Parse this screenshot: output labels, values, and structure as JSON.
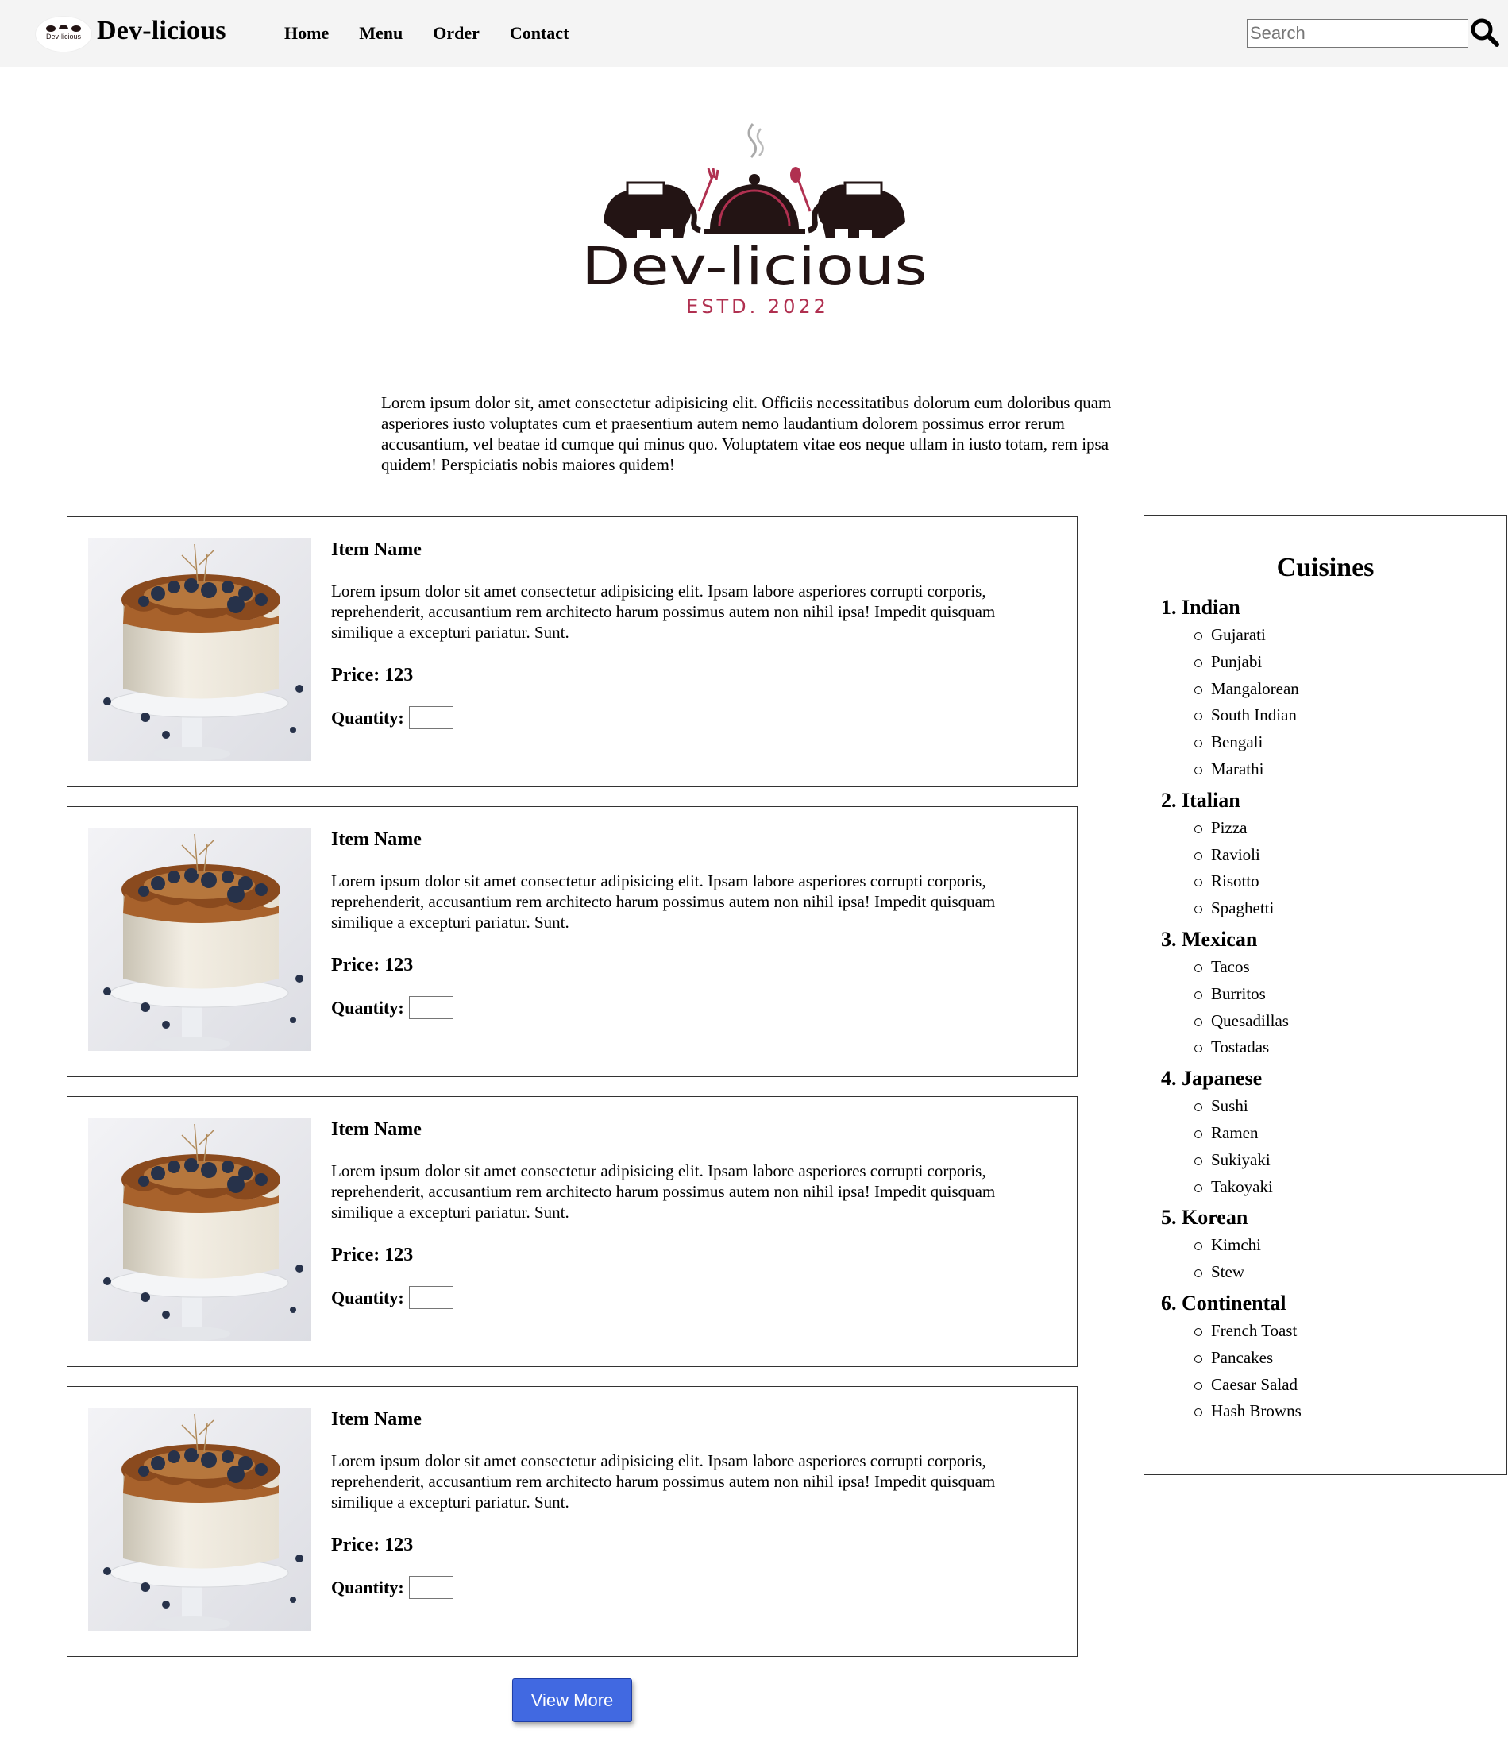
{
  "nav": {
    "logo_text": "Dev-licious",
    "brand": "Dev-licious",
    "links": [
      "Home",
      "Menu",
      "Order",
      "Contact"
    ],
    "search_placeholder": "Search"
  },
  "hero": {
    "logo_name": "Dev-licious",
    "logo_tagline": "ESTD. 2022"
  },
  "intro": "Lorem ipsum dolor sit, amet consectetur adipisicing elit. Officiis necessitatibus dolorum eum doloribus quam asperiores iusto voluptates cum et praesentium autem nemo laudantium dolorem possimus error rerum accusantium, vel beatae id cumque qui minus quo. Voluptatem vitae eos neque ullam in iusto totam, rem ipsa quidem! Perspiciatis nobis maiores quidem!",
  "items": [
    {
      "name": "Item Name",
      "description": "Lorem ipsum dolor sit amet consectetur adipisicing elit. Ipsam labore asperiores corrupti corporis, reprehenderit, accusantium rem architecto harum possimus autem non nihil ipsa! Impedit quisquam similique a excepturi pariatur. Sunt.",
      "price": "Price: 123",
      "quantity_label": "Quantity:"
    },
    {
      "name": "Item Name",
      "description": "Lorem ipsum dolor sit amet consectetur adipisicing elit. Ipsam labore asperiores corrupti corporis, reprehenderit, accusantium rem architecto harum possimus autem non nihil ipsa! Impedit quisquam similique a excepturi pariatur. Sunt.",
      "price": "Price: 123",
      "quantity_label": "Quantity:"
    },
    {
      "name": "Item Name",
      "description": "Lorem ipsum dolor sit amet consectetur adipisicing elit. Ipsam labore asperiores corrupti corporis, reprehenderit, accusantium rem architecto harum possimus autem non nihil ipsa! Impedit quisquam similique a excepturi pariatur. Sunt.",
      "price": "Price: 123",
      "quantity_label": "Quantity:"
    },
    {
      "name": "Item Name",
      "description": "Lorem ipsum dolor sit amet consectetur adipisicing elit. Ipsam labore asperiores corrupti corporis, reprehenderit, accusantium rem architecto harum possimus autem non nihil ipsa! Impedit quisquam similique a excepturi pariatur. Sunt.",
      "price": "Price: 123",
      "quantity_label": "Quantity:"
    }
  ],
  "view_more_label": "View More",
  "sidebar": {
    "title": "Cuisines",
    "cuisines": [
      {
        "name": "1. Indian",
        "dishes": [
          "Gujarati",
          "Punjabi",
          "Mangalorean",
          "South Indian",
          "Bengali",
          "Marathi"
        ]
      },
      {
        "name": "2. Italian",
        "dishes": [
          "Pizza",
          "Ravioli",
          "Risotto",
          "Spaghetti"
        ]
      },
      {
        "name": "3. Mexican",
        "dishes": [
          "Tacos",
          "Burritos",
          "Quesadillas",
          "Tostadas"
        ]
      },
      {
        "name": "4. Japanese",
        "dishes": [
          "Sushi",
          "Ramen",
          "Sukiyaki",
          "Takoyaki"
        ]
      },
      {
        "name": "5. Korean",
        "dishes": [
          "Kimchi",
          "Stew"
        ]
      },
      {
        "name": "6. Continental",
        "dishes": [
          "French Toast",
          "Pancakes",
          "Caesar Salad",
          "Hash Browns"
        ]
      }
    ]
  },
  "colors": {
    "navbar_bg": "#f4f4f4",
    "button_bg": "#4169e1",
    "logo_dark": "#231414",
    "logo_accent": "#b03050"
  }
}
